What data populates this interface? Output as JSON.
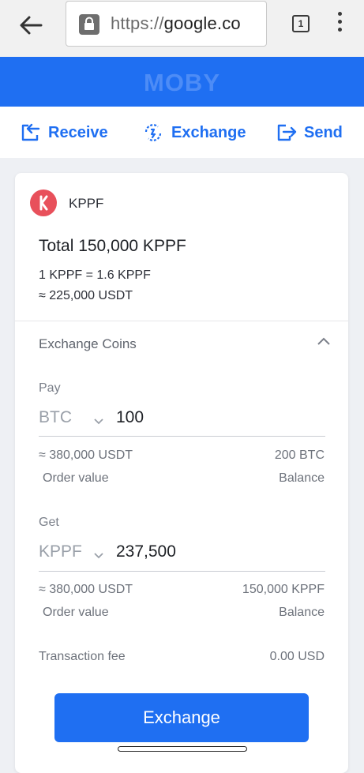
{
  "browser": {
    "url_scheme": "https://",
    "url_host": "google.co",
    "tab_count": "1"
  },
  "app": {
    "title": "MOBY"
  },
  "actions": {
    "receive": "Receive",
    "exchange": "Exchange",
    "send": "Send"
  },
  "coin": {
    "logo_letter": "K",
    "name": "KPPF",
    "total": "Total 150,000 KPPF",
    "rate": "1 KPPF = 1.6 KPPF",
    "approx": "≈ 225,000 USDT"
  },
  "exchange": {
    "title": "Exchange Coins",
    "pay": {
      "label": "Pay",
      "coin": "BTC",
      "amount": "100",
      "order_value": "≈ 380,000 USDT",
      "order_value_label": "Order value",
      "balance": "200 BTC",
      "balance_label": "Balance"
    },
    "get": {
      "label": "Get",
      "coin": "KPPF",
      "amount": "237,500",
      "order_value": "≈ 380,000 USDT",
      "order_value_label": "Order value",
      "balance": "150,000 KPPF",
      "balance_label": "Balance"
    },
    "fee_label": "Transaction fee",
    "fee_value": "0.00 USD",
    "button": "Exchange"
  },
  "colors": {
    "brand": "#1f6ff2",
    "logo": "#e8505b"
  }
}
